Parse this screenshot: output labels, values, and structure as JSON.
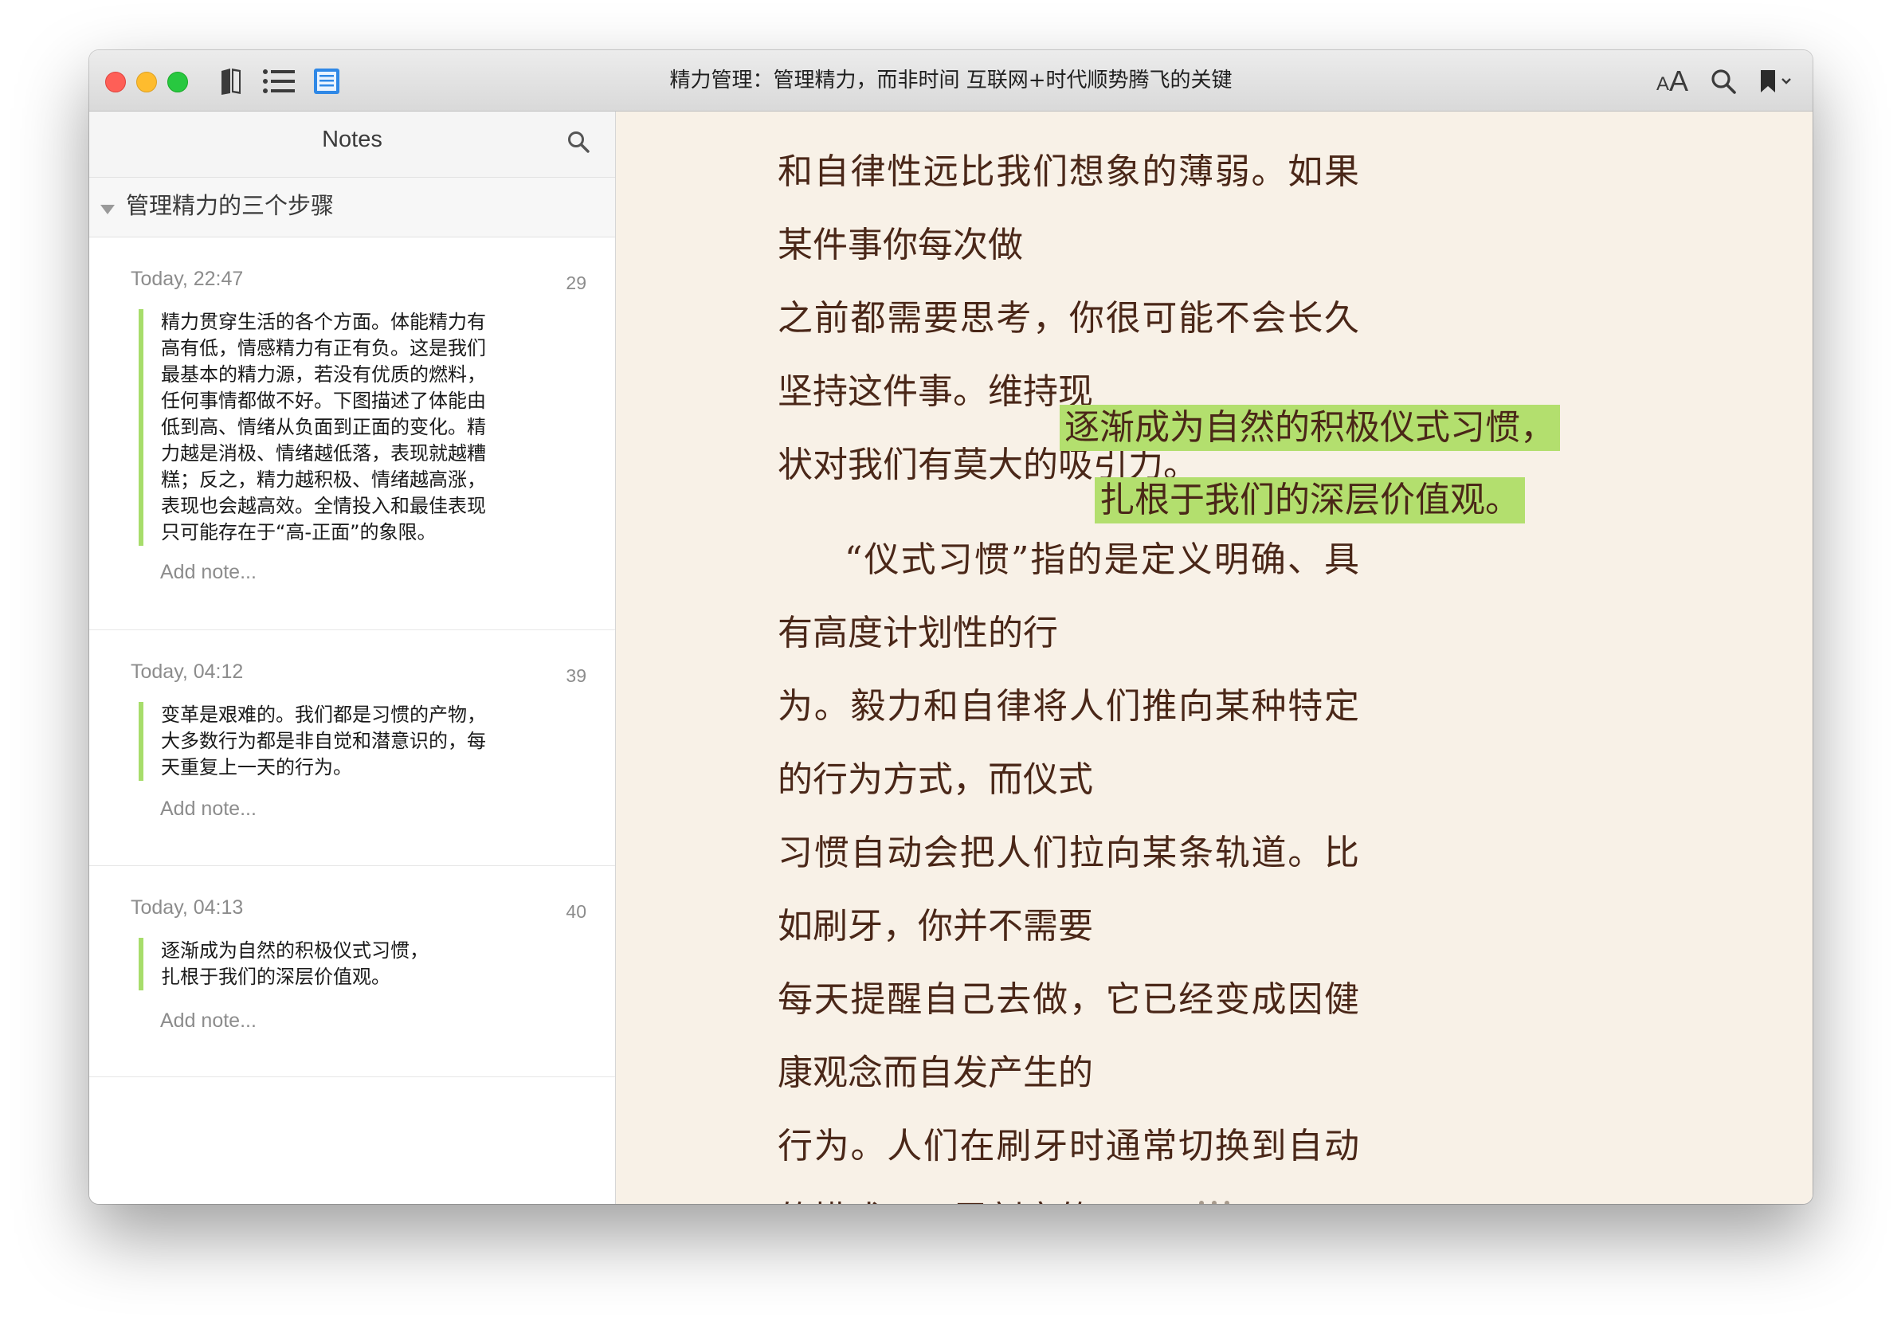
{
  "window": {
    "title": "精力管理：管理精力，而非时间 互联网+时代顺势腾飞的关键",
    "font_size_label": "AA"
  },
  "sidebar": {
    "header": "Notes",
    "chapter": "管理精力的三个步骤",
    "notes": [
      {
        "date": "Today, 22:47",
        "page": "29",
        "lines": [
          "精力贯穿生活的各个方面。体能精力有",
          "高有低，情感精力有正有负。这是我们",
          "最基本的精力源，若没有优质的燃料，",
          "任何事情都做不好。下图描述了体能由",
          "低到高、情绪从负面到正面的变化。精",
          "力越是消极、情绪越低落，表现就越糟",
          "糕；反之，精力越积极、情绪越高涨，",
          "表现也会越高效。全情投入和最佳表现",
          "只可能存在于“高-正面”的象限。"
        ],
        "add_note": "Add note..."
      },
      {
        "date": "Today, 04:12",
        "page": "39",
        "lines": [
          "变革是艰难的。我们都是习惯的产物，",
          "大多数行为都是非自觉和潜意识的，每",
          "天重复上一天的行为。"
        ],
        "add_note": "Add note..."
      },
      {
        "date": "Today, 04:13",
        "page": "40",
        "lines": [
          "逐渐成为自然的积极仪式习惯，",
          "扎根于我们的深层价值观。"
        ],
        "add_note": "Add note..."
      }
    ]
  },
  "content": {
    "para1": [
      "和自律性远比我们想象的薄弱。如果某件事你每次做",
      "之前都需要思考，你很可能不会长久坚持这件事。维持现",
      "状对我们有莫大的吸引力。"
    ],
    "highlight": [
      "逐渐成为自然的积极仪式习惯，",
      "扎根于我们的深层价值观。"
    ],
    "para2": [
      "“仪式习惯”指的是定义明确、具有高度计划性的行",
      "为。毅力和自律将人们推向某种特定的行为方式，而仪式",
      "习惯自动会把人们拉向某条轨道。比如刷牙，你并不需要",
      "每天提醒自己去做，它已经变成因健康观念而自发产生的",
      "行为。人们在刷牙时通常切换到自动的模式，不需刻意的"
    ]
  },
  "colors": {
    "highlight": "#b3df6e",
    "note_bar": "#a7dd6b",
    "page_bg": "#f8f1e7",
    "text": "#4a2718"
  }
}
